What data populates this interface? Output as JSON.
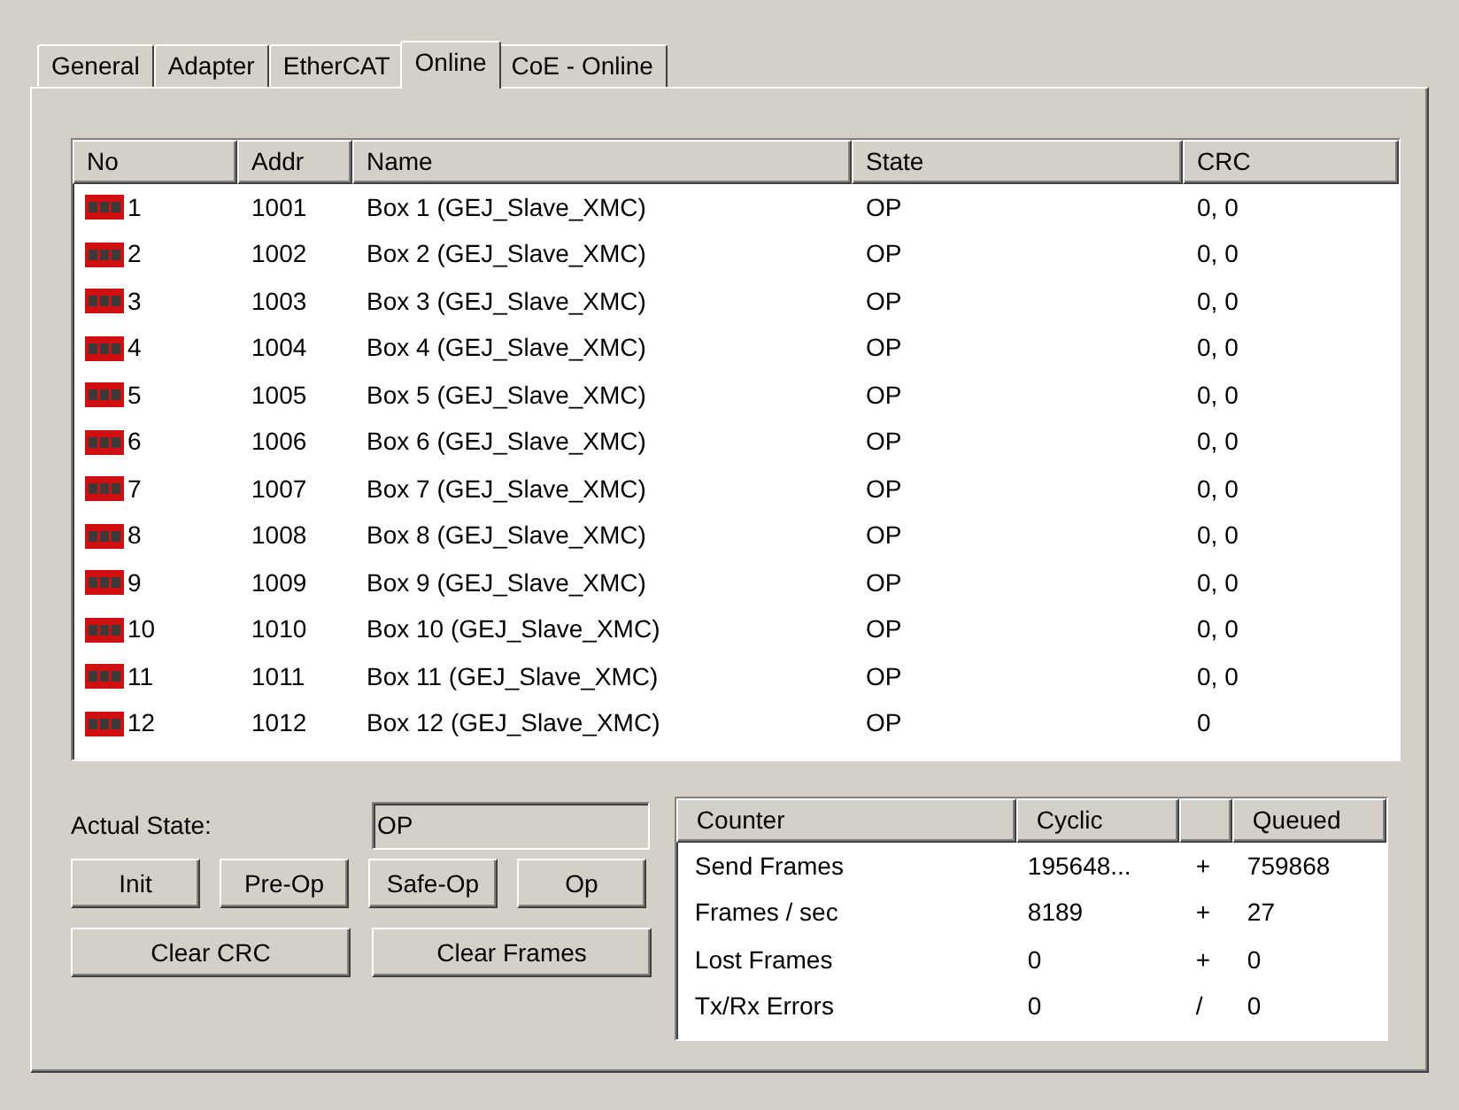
{
  "tabs": [
    {
      "label": "General",
      "selected": false
    },
    {
      "label": "Adapter",
      "selected": false
    },
    {
      "label": "EtherCAT",
      "selected": false
    },
    {
      "label": "Online",
      "selected": true
    },
    {
      "label": "CoE - Online",
      "selected": false
    }
  ],
  "slaves": {
    "columns": [
      "No",
      "Addr",
      "Name",
      "State",
      "CRC"
    ],
    "rows": [
      {
        "no": "1",
        "addr": "1001",
        "name": "Box 1 (GEJ_Slave_XMC)",
        "state": "OP",
        "crc": "0, 0"
      },
      {
        "no": "2",
        "addr": "1002",
        "name": "Box 2 (GEJ_Slave_XMC)",
        "state": "OP",
        "crc": "0, 0"
      },
      {
        "no": "3",
        "addr": "1003",
        "name": "Box 3 (GEJ_Slave_XMC)",
        "state": "OP",
        "crc": "0, 0"
      },
      {
        "no": "4",
        "addr": "1004",
        "name": "Box 4 (GEJ_Slave_XMC)",
        "state": "OP",
        "crc": "0, 0"
      },
      {
        "no": "5",
        "addr": "1005",
        "name": "Box 5 (GEJ_Slave_XMC)",
        "state": "OP",
        "crc": "0, 0"
      },
      {
        "no": "6",
        "addr": "1006",
        "name": "Box 6 (GEJ_Slave_XMC)",
        "state": "OP",
        "crc": "0, 0"
      },
      {
        "no": "7",
        "addr": "1007",
        "name": "Box 7 (GEJ_Slave_XMC)",
        "state": "OP",
        "crc": "0, 0"
      },
      {
        "no": "8",
        "addr": "1008",
        "name": "Box 8 (GEJ_Slave_XMC)",
        "state": "OP",
        "crc": "0, 0"
      },
      {
        "no": "9",
        "addr": "1009",
        "name": "Box 9 (GEJ_Slave_XMC)",
        "state": "OP",
        "crc": "0, 0"
      },
      {
        "no": "10",
        "addr": "1010",
        "name": "Box 10 (GEJ_Slave_XMC)",
        "state": "OP",
        "crc": "0, 0"
      },
      {
        "no": "11",
        "addr": "1011",
        "name": "Box 11 (GEJ_Slave_XMC)",
        "state": "OP",
        "crc": "0, 0"
      },
      {
        "no": "12",
        "addr": "1012",
        "name": "Box 12 (GEJ_Slave_XMC)",
        "state": "OP",
        "crc": "0"
      }
    ]
  },
  "actual_state": {
    "label": "Actual State:",
    "value": "OP"
  },
  "state_buttons": [
    "Init",
    "Pre-Op",
    "Safe-Op",
    "Op"
  ],
  "clear_buttons": [
    "Clear CRC",
    "Clear Frames"
  ],
  "counters": {
    "columns": [
      "Counter",
      "Cyclic",
      "",
      "Queued"
    ],
    "rows": [
      {
        "counter": "Send Frames",
        "cyclic": "195648...",
        "op": "+",
        "queued": "759868"
      },
      {
        "counter": "Frames / sec",
        "cyclic": "8189",
        "op": "+",
        "queued": "27"
      },
      {
        "counter": "Lost Frames",
        "cyclic": "0",
        "op": "+",
        "queued": "0"
      },
      {
        "counter": "Tx/Rx Errors",
        "cyclic": "0",
        "op": "/",
        "queued": "0"
      }
    ]
  }
}
